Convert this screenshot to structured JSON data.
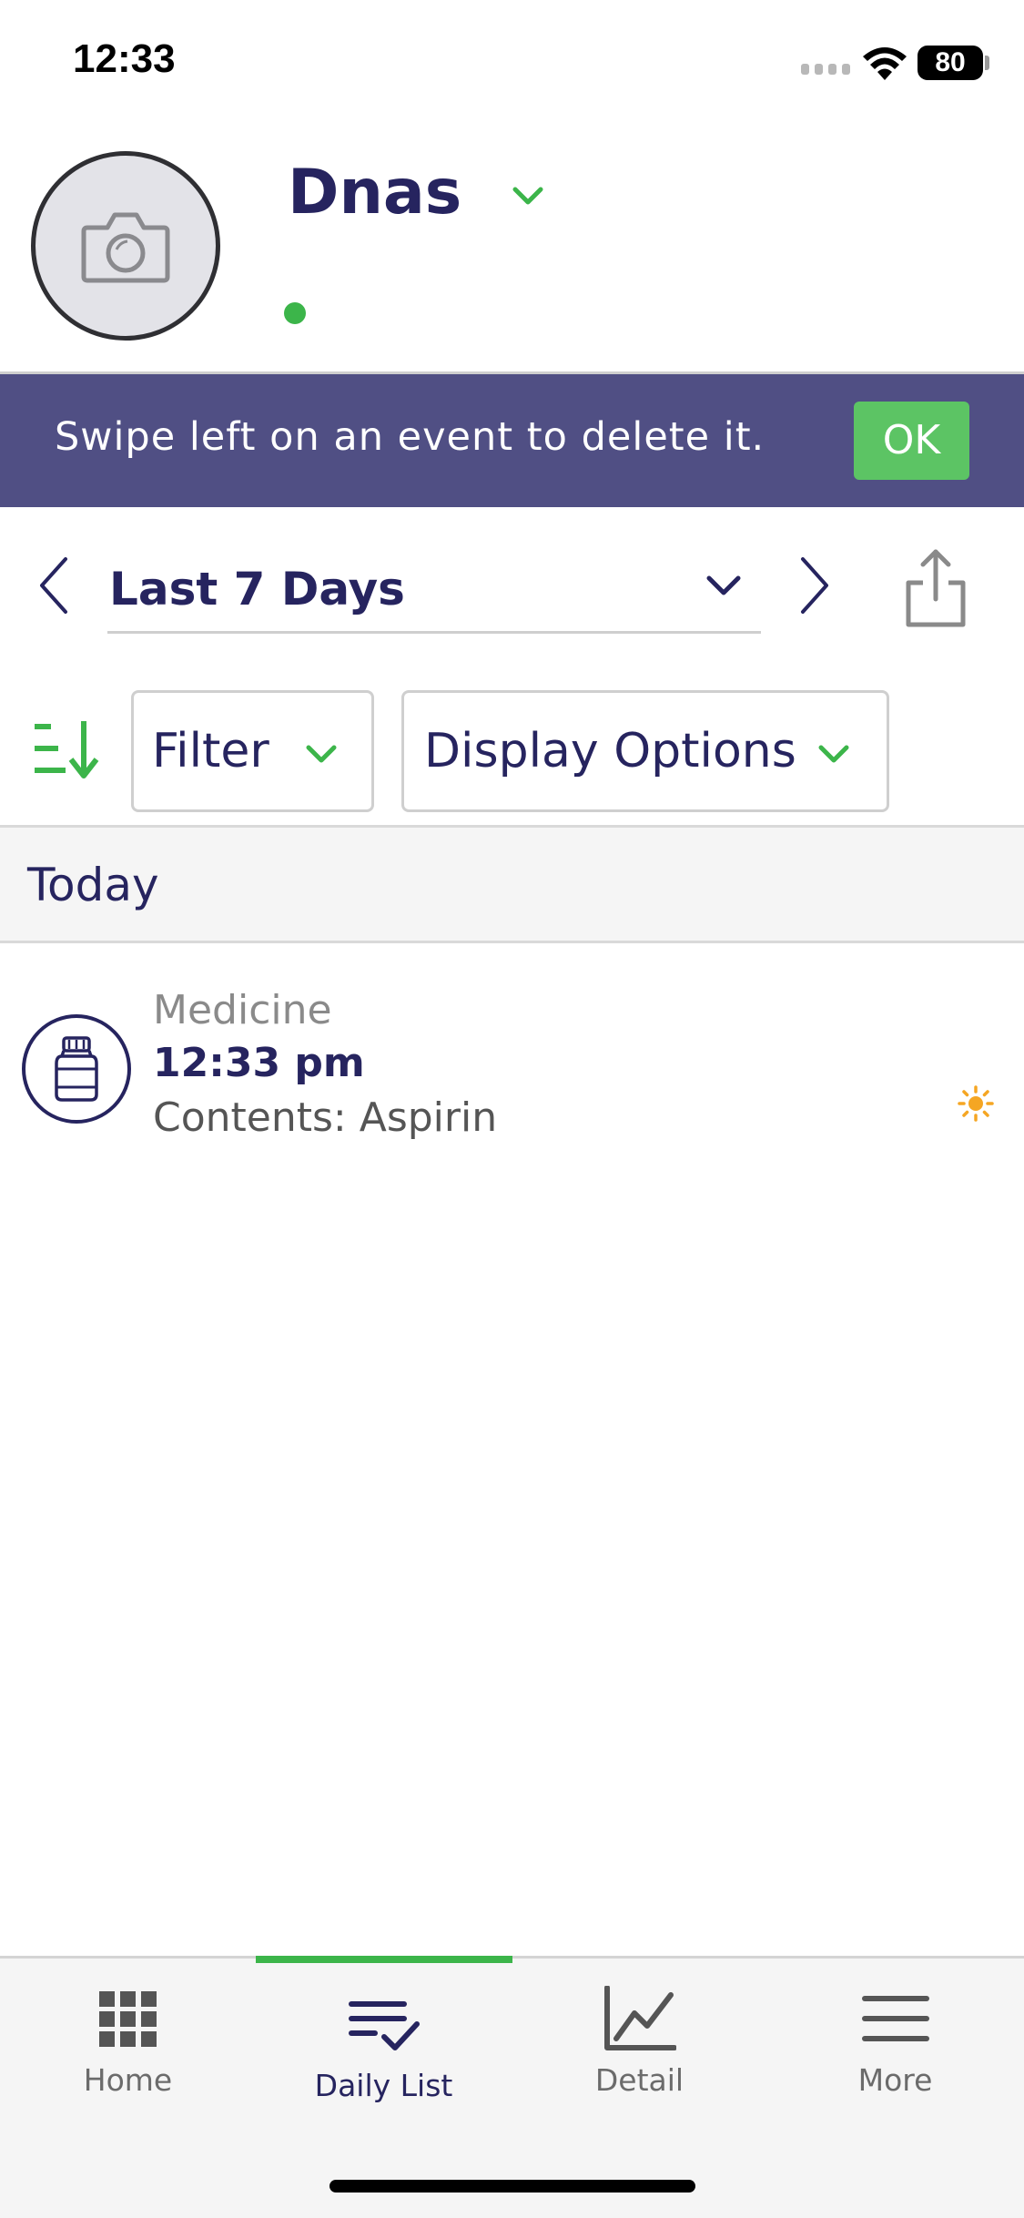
{
  "status_bar": {
    "time": "12:33",
    "battery": "80"
  },
  "profile": {
    "name": "Dnas"
  },
  "banner": {
    "message": "Swipe left on an event to delete it.",
    "ok_label": "OK"
  },
  "range": {
    "label": "Last 7 Days"
  },
  "toolbar": {
    "filter_label": "Filter",
    "display_options_label": "Display Options"
  },
  "section": {
    "title": "Today"
  },
  "events": [
    {
      "type": "Medicine",
      "time": "12:33 pm",
      "contents": "Contents: Aspirin",
      "icon": "medicine-bottle-icon",
      "badge_icon": "sun-icon"
    }
  ],
  "tabs": [
    {
      "label": "Home",
      "icon": "grid-icon"
    },
    {
      "label": "Daily List",
      "icon": "list-check-icon",
      "active": true
    },
    {
      "label": "Detail",
      "icon": "line-chart-icon"
    },
    {
      "label": "More",
      "icon": "menu-icon"
    }
  ],
  "colors": {
    "accent_green": "#3cb54a",
    "navy": "#26245f",
    "banner": "#504f84",
    "ok_button": "#5cc464",
    "sun": "#f5a623"
  }
}
